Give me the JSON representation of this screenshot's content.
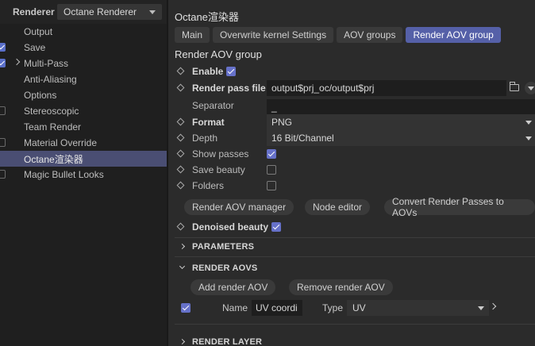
{
  "sidebar": {
    "renderer_label": "Renderer",
    "renderer_value": "Octane Renderer",
    "items": [
      {
        "label": "Output",
        "check": "none",
        "arrow": false,
        "active": false
      },
      {
        "label": "Save",
        "check": "on",
        "arrow": false,
        "active": false
      },
      {
        "label": "Multi-Pass",
        "check": "on",
        "arrow": true,
        "active": false
      },
      {
        "label": "Anti-Aliasing",
        "check": "none",
        "arrow": false,
        "active": false
      },
      {
        "label": "Options",
        "check": "none",
        "arrow": false,
        "active": false
      },
      {
        "label": "Stereoscopic",
        "check": "off",
        "arrow": false,
        "active": false
      },
      {
        "label": "Team Render",
        "check": "none",
        "arrow": false,
        "active": false
      },
      {
        "label": "Material Override",
        "check": "off",
        "arrow": false,
        "active": false
      },
      {
        "label": "Octane渲染器",
        "check": "none",
        "arrow": false,
        "active": true
      },
      {
        "label": "Magic Bullet Looks",
        "check": "off",
        "arrow": false,
        "active": false
      }
    ]
  },
  "main": {
    "title": "Octane渲染器",
    "tabs": [
      {
        "label": "Main",
        "active": false
      },
      {
        "label": "Overwrite kernel Settings",
        "active": false
      },
      {
        "label": "AOV groups",
        "active": false
      },
      {
        "label": "Render AOV group",
        "active": true
      }
    ],
    "section_title": "Render AOV group",
    "enable_label": "Enable",
    "enable_checked": true,
    "render_pass_file_label": "Render pass file",
    "render_pass_file_value": "output$prj_oc/output$prj",
    "separator_label": "Separator",
    "separator_value": "_",
    "format_label": "Format",
    "format_value": "PNG",
    "depth_label": "Depth",
    "depth_value": "16 Bit/Channel",
    "show_passes_label": "Show passes",
    "show_passes_checked": true,
    "save_beauty_label": "Save beauty",
    "save_beauty_checked": false,
    "folders_label": "Folders",
    "folders_checked": false,
    "buttons": {
      "render_aov_manager": "Render AOV manager",
      "node_editor": "Node editor",
      "convert_passes": "Convert Render Passes to AOVs"
    },
    "denoised_beauty_label": "Denoised beauty",
    "denoised_beauty_checked": true,
    "parameters_label": "PARAMETERS",
    "render_aovs_label": "RENDER AOVS",
    "add_render_aov": "Add render AOV",
    "remove_render_aov": "Remove render AOV",
    "aov_item": {
      "checked": true,
      "name_label": "Name",
      "name_value": "UV coordi",
      "type_label": "Type",
      "type_value": "UV"
    },
    "render_layer_label": "RENDER LAYER"
  },
  "colors": {
    "accent": "#5560a8",
    "checkbox": "#6671c9",
    "active_sidebar": "#4a4e73"
  }
}
